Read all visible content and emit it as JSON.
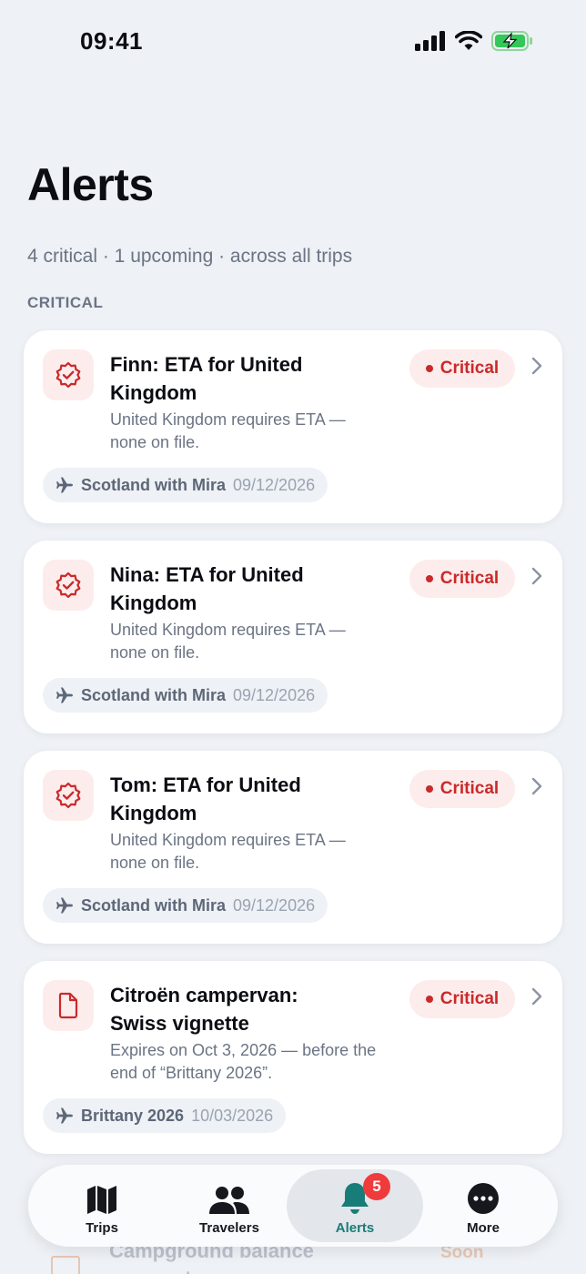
{
  "status_bar": {
    "time": "09:41"
  },
  "header": {
    "title": "Alerts",
    "subtitle": "4 critical · 1 upcoming · across all trips",
    "section": "CRITICAL"
  },
  "alerts": [
    {
      "title": "Finn: ETA for United Kingdom",
      "desc": "United Kingdom requires ETA — none on file.",
      "badge": "Critical",
      "trip": "Scotland with Mira",
      "date": "09/12/2026",
      "icon": "shield-check-icon"
    },
    {
      "title": "Nina: ETA for United Kingdom",
      "desc": "United Kingdom requires ETA — none on file.",
      "badge": "Critical",
      "trip": "Scotland with Mira",
      "date": "09/12/2026",
      "icon": "shield-check-icon"
    },
    {
      "title": "Tom: ETA for United Kingdom",
      "desc": "United Kingdom requires ETA — none on file.",
      "badge": "Critical",
      "trip": "Scotland with Mira",
      "date": "09/12/2026",
      "icon": "shield-check-icon"
    },
    {
      "title": "Citroën campervan: Swiss vignette",
      "desc": "Expires on Oct 3, 2026 — before the end of “Brittany 2026”.",
      "badge": "Critical",
      "trip": "Brittany 2026",
      "date": "10/03/2026",
      "icon": "document-icon"
    }
  ],
  "partial_card": {
    "title": "Campground balance payment",
    "badge": "Soon"
  },
  "tabs": [
    {
      "label": "Trips",
      "icon": "map-icon"
    },
    {
      "label": "Travelers",
      "icon": "people-icon"
    },
    {
      "label": "Alerts",
      "icon": "bell-icon",
      "badge": "5"
    },
    {
      "label": "More",
      "icon": "more-icon"
    }
  ],
  "colors": {
    "critical": "#c92a2a",
    "accent": "#187d78",
    "badge": "#ef3b3b"
  }
}
